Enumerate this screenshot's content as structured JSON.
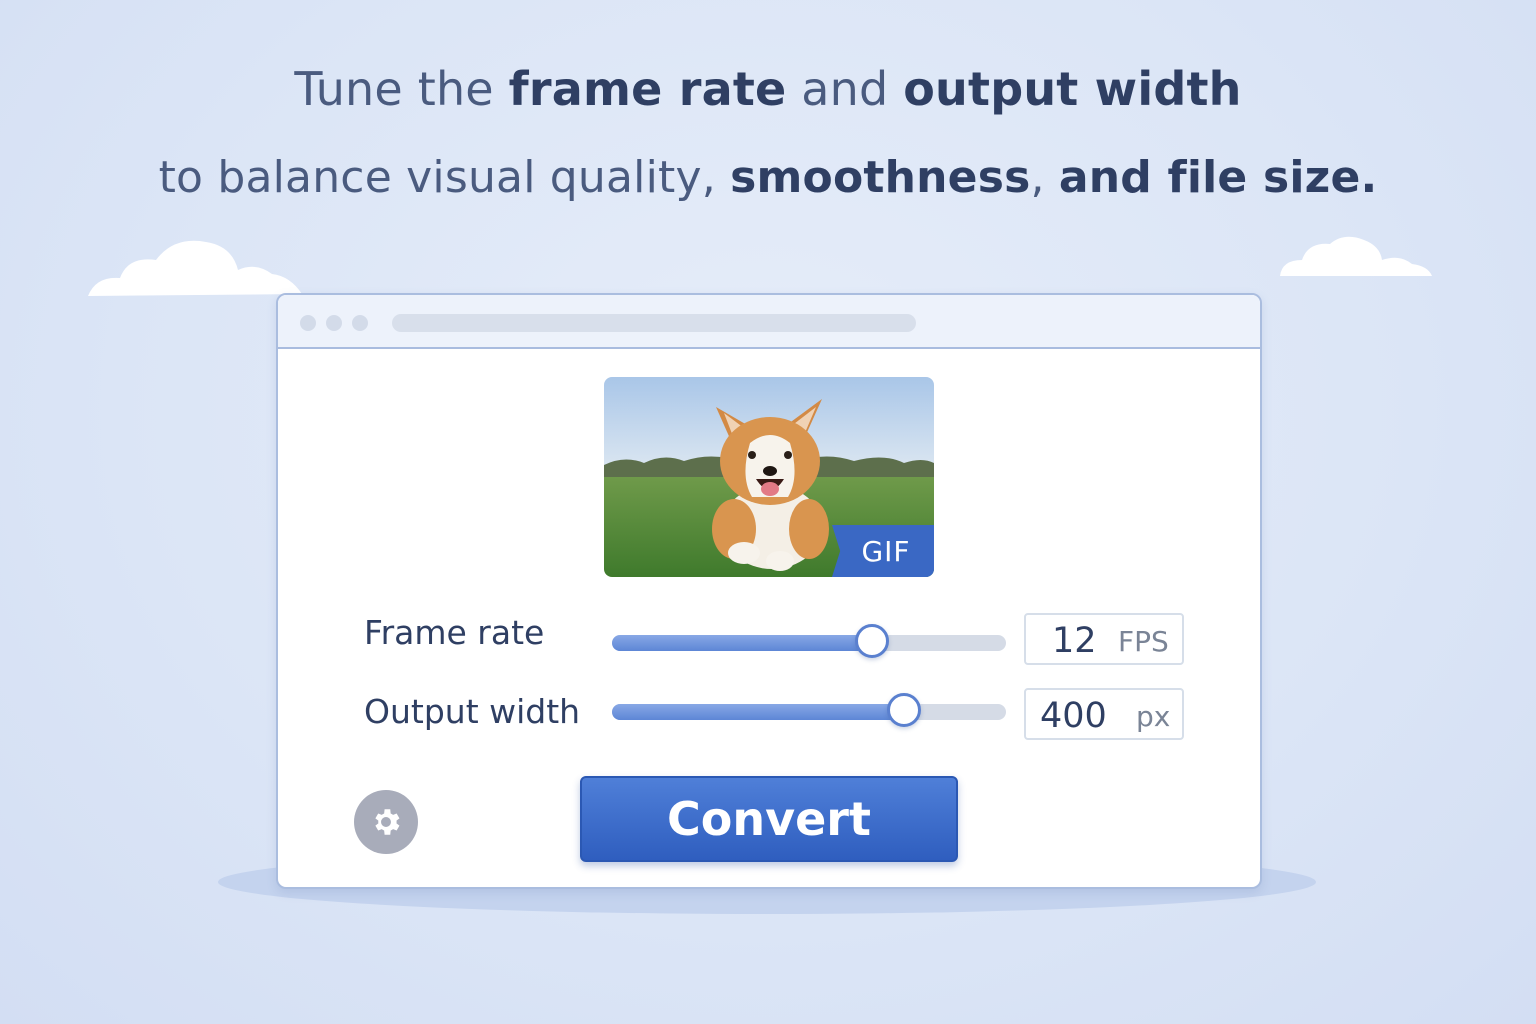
{
  "headline": {
    "line1": [
      {
        "text": "Tune the ",
        "bold": false
      },
      {
        "text": "frame rate",
        "bold": true
      },
      {
        "text": " and ",
        "bold": false
      },
      {
        "text": "output width",
        "bold": true
      }
    ],
    "line2": [
      {
        "text": "to balance visual quality, ",
        "bold": false
      },
      {
        "text": "smoothness",
        "bold": true
      },
      {
        "text": ", ",
        "bold": false
      },
      {
        "text": "and file size.",
        "bold": true
      }
    ]
  },
  "preview": {
    "badge": "GIF",
    "image": "running-corgi-on-grass"
  },
  "controls": {
    "frame_rate": {
      "label": "Frame rate",
      "value": "12",
      "unit": "FPS",
      "slider_fraction": 0.66
    },
    "output_width": {
      "label": "Output width",
      "value": "400",
      "unit": "px",
      "slider_fraction": 0.74
    }
  },
  "actions": {
    "convert_label": "Convert",
    "settings_icon": "gear-icon"
  },
  "colors": {
    "accent": "#3a68c4",
    "background": "#dbe5f6",
    "text": "#2f3f63"
  }
}
